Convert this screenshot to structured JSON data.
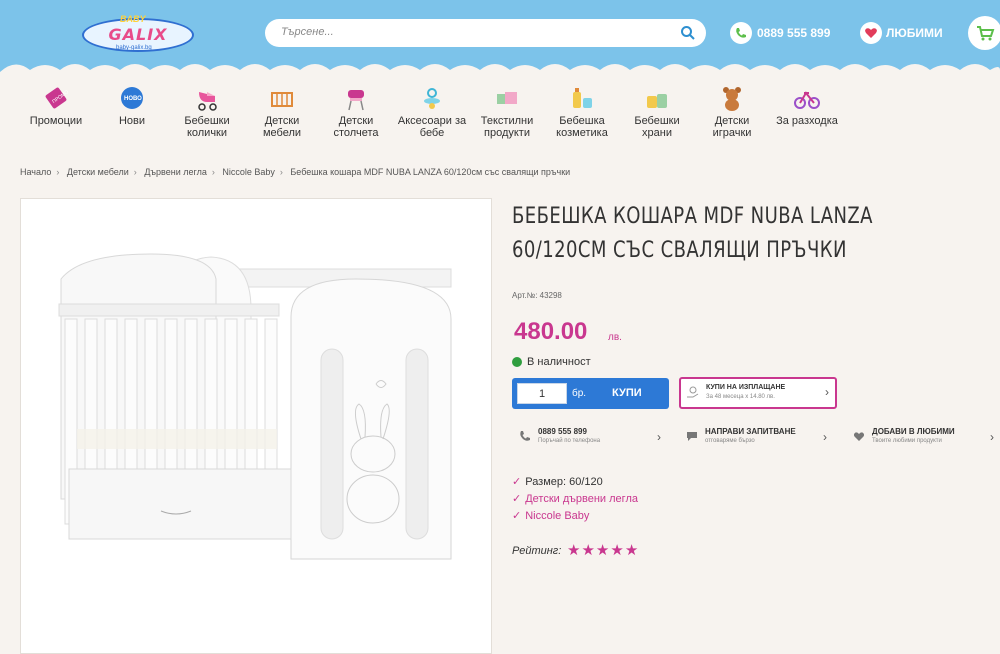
{
  "header": {
    "logo": {
      "baby": "BABY",
      "main": "GALIX",
      "sub": "baby-galix.bg"
    },
    "search_placeholder": "Търсене...",
    "phone": "0889 555 899",
    "favorites_label": "ЛЮБИМИ"
  },
  "categories": [
    {
      "label": "Промоции",
      "icon": "promo-tag-icon"
    },
    {
      "label": "Нови",
      "icon": "new-badge-icon"
    },
    {
      "label": "Бебешки колички",
      "icon": "stroller-icon"
    },
    {
      "label": "Детски мебели",
      "icon": "crib-icon"
    },
    {
      "label": "Детски столчета",
      "icon": "high-chair-icon"
    },
    {
      "label": "Аксесоари за бебе",
      "icon": "pacifier-icon"
    },
    {
      "label": "Текстилни продукти",
      "icon": "textile-icon"
    },
    {
      "label": "Бебешка козметика",
      "icon": "cosmetics-icon"
    },
    {
      "label": "Бебешки храни",
      "icon": "baby-food-icon"
    },
    {
      "label": "Детски играчки",
      "icon": "teddy-bear-icon"
    },
    {
      "label": "За разходка",
      "icon": "tricycle-icon"
    }
  ],
  "breadcrumb": [
    "Начало",
    "Детски мебели",
    "Дървени легла",
    "Niccole Baby",
    "Бебешка кошара MDF NUBA LANZA 60/120см със свалящи пръчки"
  ],
  "product": {
    "title": "Бебешка кошара MDF NUBA LANZA 60/120см със свалящи пръчки",
    "sku": "Арт.№: 43298",
    "price": "480.00",
    "currency": "лв.",
    "stock": "В наличност",
    "quantity": "1",
    "unit": "бр.",
    "buy_label": "КУПИ",
    "leasing": {
      "title": "КУПИ НА ИЗПЛАЩАНЕ",
      "sub": "За 48 месеца х 14.80 лв."
    },
    "actions": [
      {
        "title": "0889 555 899",
        "sub": "Поръчай по телефона",
        "icon": "phone-icon"
      },
      {
        "title": "НАПРАВИ ЗАПИТВАНЕ",
        "sub": "отговаряме бързо",
        "icon": "chat-icon"
      },
      {
        "title": "ДОБАВИ В ЛЮБИМИ",
        "sub": "Твоите любими продукти",
        "icon": "heart-icon"
      }
    ],
    "attributes": {
      "size": "Размер: 60/120",
      "category": "Детски дървени легла",
      "brand": "Niccole Baby"
    },
    "rating_label": "Рейтинг:",
    "rating": 5
  },
  "colors": {
    "header_blue": "#7cc3ea",
    "accent_pink": "#c9378f",
    "buy_blue": "#2d79d6",
    "stock_green": "#2f9e3f"
  }
}
